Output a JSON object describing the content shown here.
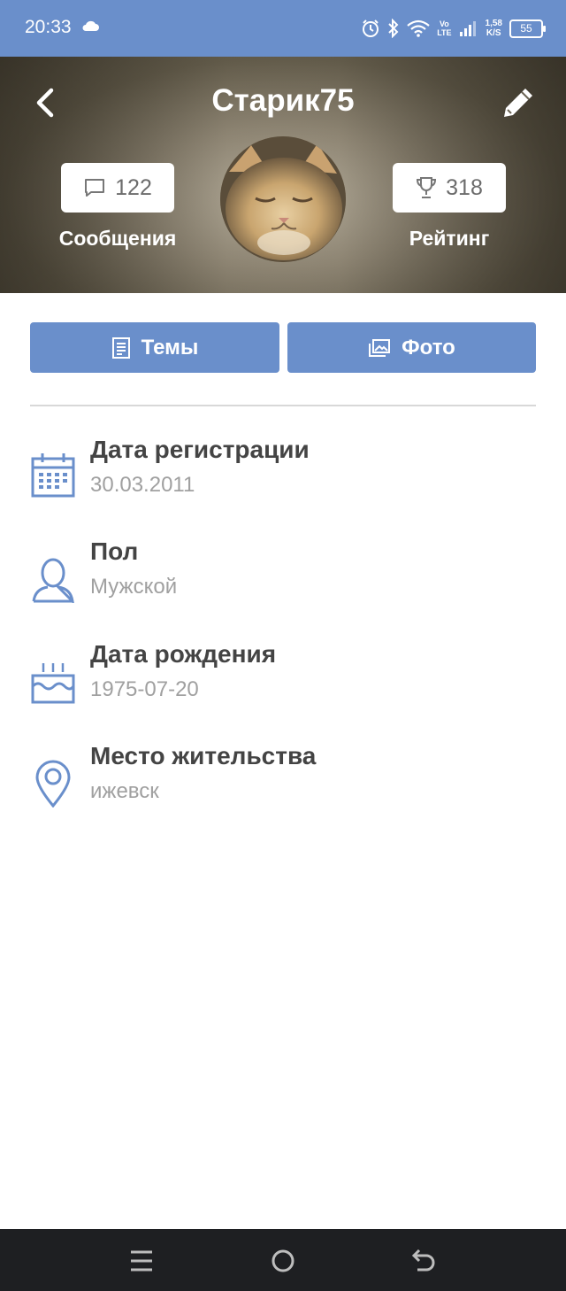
{
  "status_bar": {
    "time": "20:33",
    "network_top": "Vo",
    "network_bottom": "LTE",
    "speed_top": "1,58",
    "speed_bottom": "K/S",
    "battery": "55"
  },
  "profile": {
    "username": "Старик75",
    "messages": {
      "count": "122",
      "label": "Сообщения"
    },
    "rating": {
      "count": "318",
      "label": "Рейтинг"
    }
  },
  "tabs": {
    "topics": "Темы",
    "photos": "Фото"
  },
  "info": [
    {
      "title": "Дата регистрации",
      "value": "30.03.2011",
      "icon": "calendar-icon"
    },
    {
      "title": "Пол",
      "value": "Мужской",
      "icon": "person-icon"
    },
    {
      "title": "Дата рождения",
      "value": "1975-07-20",
      "icon": "birthday-cake-icon"
    },
    {
      "title": "Место жительства",
      "value": "ижевск",
      "icon": "location-pin-icon"
    }
  ],
  "colors": {
    "accent": "#6a8fcb",
    "icon_blue": "#6a8fcb",
    "navbar": "#1e1f22"
  }
}
